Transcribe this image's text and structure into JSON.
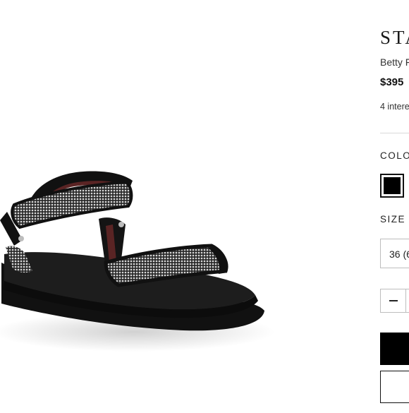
{
  "product": {
    "brand": "STA",
    "name": "Betty F",
    "price": "$395",
    "interest": "4 intere"
  },
  "color": {
    "label": "COLOR",
    "selected_swatch": "#000000"
  },
  "size": {
    "label": "SIZE",
    "selected_value": "36 (6"
  },
  "quantity": {
    "decrease_icon": "minus-icon"
  },
  "colors": {
    "swatch_black": "#000000",
    "primary_button": "#000000",
    "divider": "#d9d9d9",
    "border": "#bdbdbd",
    "rhinestone": "#c9c9c9",
    "lining": "#5a2424"
  }
}
